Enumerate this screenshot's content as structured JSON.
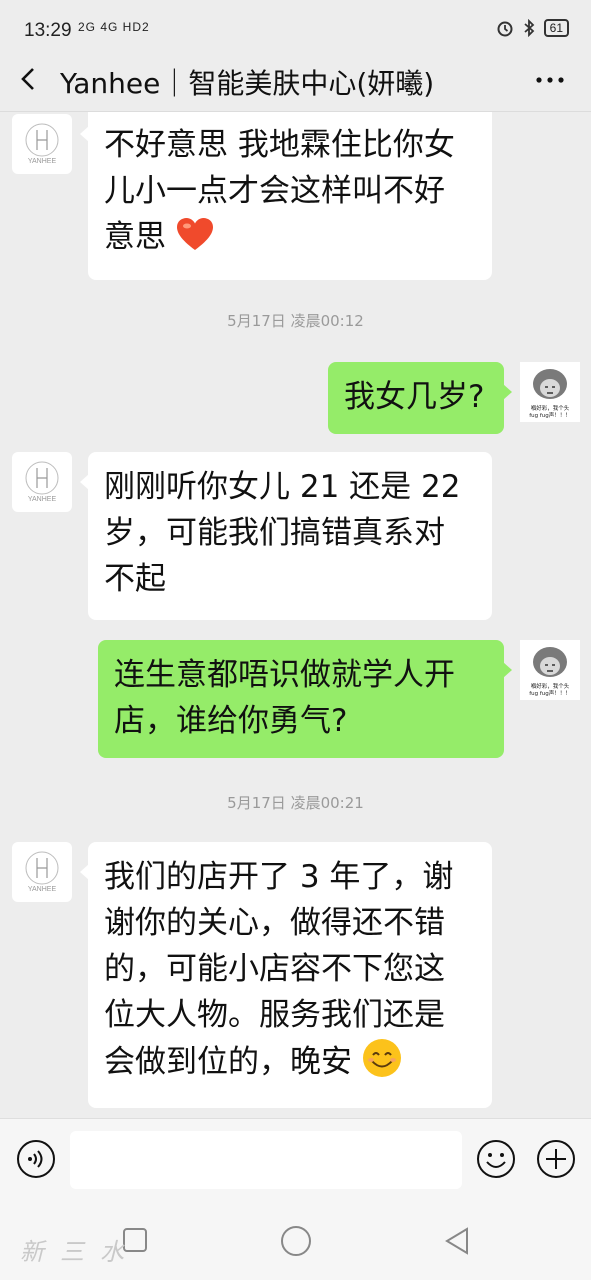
{
  "status_bar": {
    "time": "13:29",
    "signal": "2G 4G HD2",
    "battery": "61"
  },
  "header": {
    "title": "Yanhee｜智能美肤中心(妍曦)"
  },
  "avatars": {
    "shop_logo_text": "YANHEE",
    "user_caption": "嗰好彩，我个头fug fug声！！！"
  },
  "messages": [
    {
      "type": "in",
      "text": "不好意思 我地霖住比你女儿小一点才会这样叫不好意思"
    },
    {
      "type": "timestamp",
      "text": "5月17日 凌晨00:12"
    },
    {
      "type": "out",
      "text": "我女几岁?"
    },
    {
      "type": "in",
      "text": "刚刚听你女儿 21 还是 22 岁，可能我们搞错真系对不起"
    },
    {
      "type": "out",
      "text": "连生意都唔识做就学人开店，谁给你勇气?"
    },
    {
      "type": "timestamp",
      "text": "5月17日 凌晨00:21"
    },
    {
      "type": "in",
      "text": "我们的店开了 3 年了，谢谢你的关心，做得还不错的，可能小店容不下您这位大人物。服务我们还是会做到位的，晚安"
    }
  ],
  "bubble_lines": {
    "m0": [
      "不好意思 我地霖住比你女",
      "儿小一点才会这样叫不好",
      "意思"
    ],
    "m2": [
      "我女几岁?"
    ],
    "m3": [
      "刚刚听你女儿 21 还是 22",
      "岁，可能我们搞错真系对",
      "不起"
    ],
    "m4": [
      "连生意都唔识做就学人开",
      "店，谁给你勇气?"
    ],
    "m6": [
      "我们的店开了 3 年了，谢",
      "谢你的关心，做得还不错",
      "的，可能小店容不下您这",
      "位大人物。服务我们还是",
      "会做到位的，晚安"
    ]
  },
  "input": {
    "placeholder": ""
  },
  "watermark": "新三水",
  "colors": {
    "outgoing_bubble": "#95ec69",
    "incoming_bubble": "#ffffff",
    "background": "#ededed"
  },
  "icons": [
    "back-icon",
    "more-icon",
    "voice-icon",
    "emoji-icon",
    "plus-icon",
    "heart-emoji",
    "smile-emoji"
  ]
}
